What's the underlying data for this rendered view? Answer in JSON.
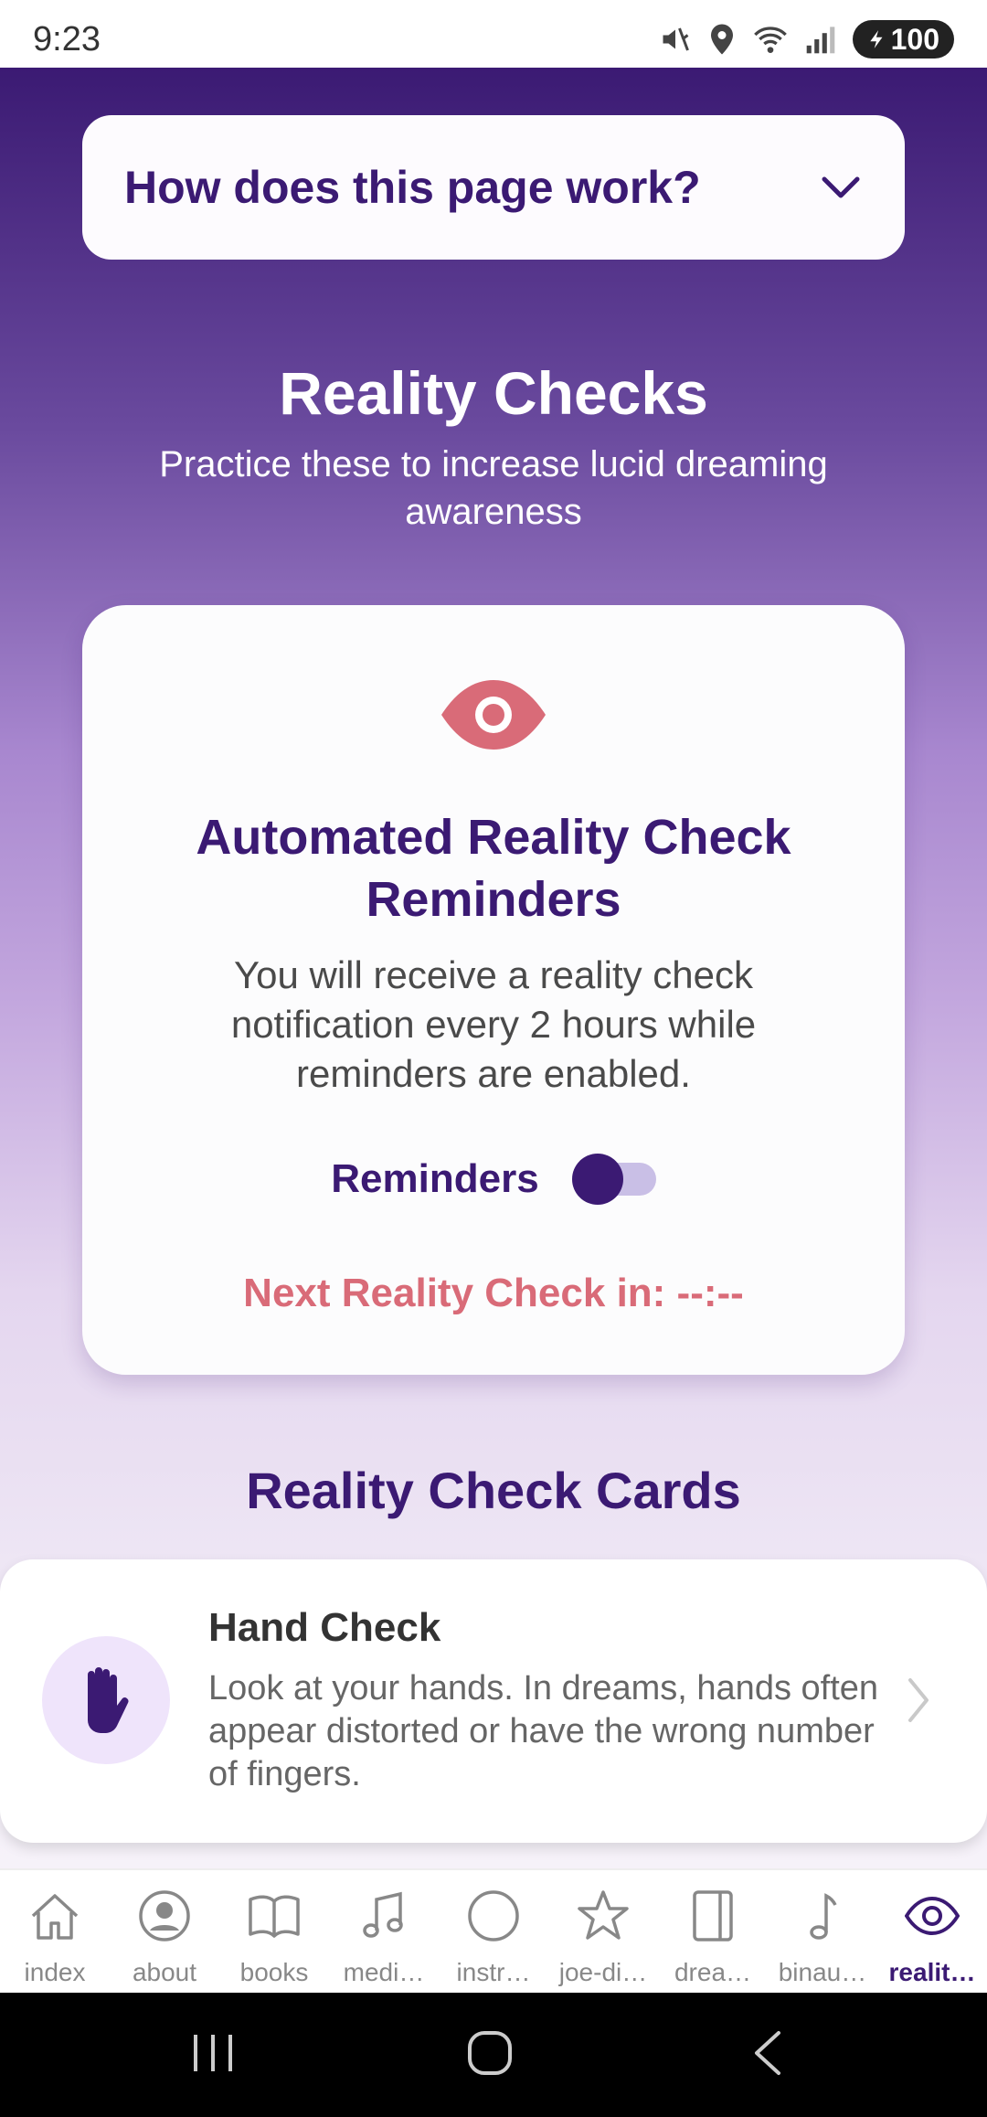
{
  "status_bar": {
    "time": "9:23",
    "battery": "100"
  },
  "help": {
    "title": "How does this page work?"
  },
  "header": {
    "title": "Reality Checks",
    "subtitle": "Practice these to increase lucid dreaming awareness"
  },
  "reminder_card": {
    "title": "Automated Reality Check Reminders",
    "description": "You will receive a reality check notification every 2 hours while reminders are enabled.",
    "toggle_label": "Reminders",
    "next_check": "Next Reality Check in: --:--"
  },
  "cards": {
    "heading": "Reality Check Cards",
    "items": [
      {
        "title": "Hand Check",
        "description": "Look at your hands. In dreams, hands often appear distorted or have the wrong number of fingers."
      }
    ]
  },
  "bottom_nav": {
    "items": [
      {
        "label": "index",
        "icon": "home-icon"
      },
      {
        "label": "about",
        "icon": "user-circle-icon"
      },
      {
        "label": "books",
        "icon": "book-icon"
      },
      {
        "label": "medi…",
        "icon": "music-note-icon"
      },
      {
        "label": "instr…",
        "icon": "circle-icon"
      },
      {
        "label": "joe-di…",
        "icon": "star-icon"
      },
      {
        "label": "drea…",
        "icon": "book-open-icon"
      },
      {
        "label": "binau…",
        "icon": "note-icon"
      },
      {
        "label": "realit…",
        "icon": "eye-icon"
      }
    ],
    "active_index": 8
  },
  "colors": {
    "primary": "#3b1a73",
    "accent": "#d96b78",
    "toggle_track": "#c9bfe6"
  }
}
